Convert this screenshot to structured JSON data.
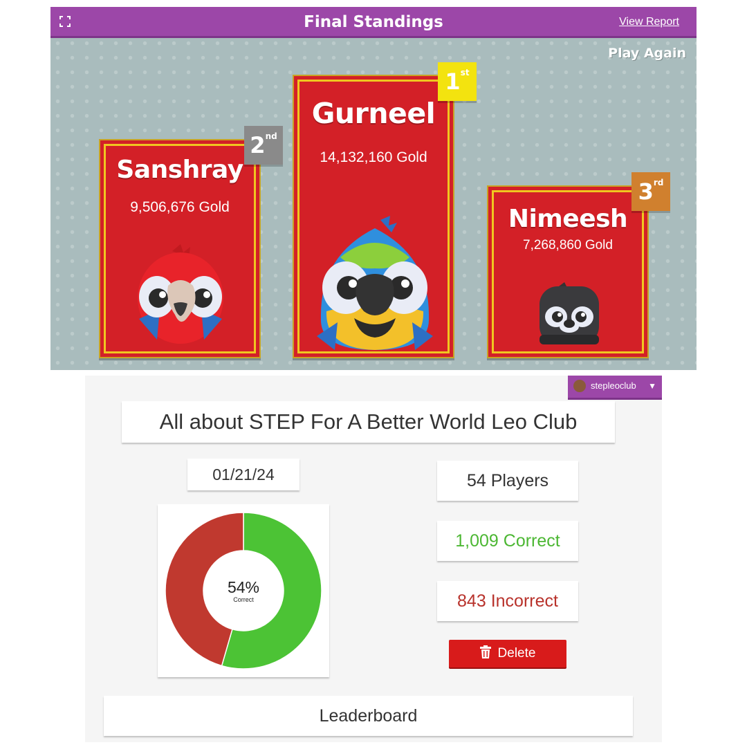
{
  "header": {
    "title": "Final Standings",
    "view_report": "View Report",
    "play_again": "Play Again"
  },
  "podium": [
    {
      "place": 2,
      "rank_label": "2",
      "rank_suffix": "nd",
      "name": "Sanshray",
      "gold": "9,506,676 Gold",
      "avatar": "red-parrot-icon",
      "rank_color": "#8a8a8a"
    },
    {
      "place": 1,
      "rank_label": "1",
      "rank_suffix": "st",
      "name": "Gurneel",
      "gold": "14,132,160 Gold",
      "avatar": "macaw-icon",
      "rank_color": "#f3e30f"
    },
    {
      "place": 3,
      "rank_label": "3",
      "rank_suffix": "rd",
      "name": "Nimeesh",
      "gold": "7,268,860 Gold",
      "avatar": "penguin-icon",
      "rank_color": "#d0802e"
    }
  ],
  "report": {
    "user": "stepleoclub",
    "kit_title": "All about STEP For A Better World Leo Club",
    "date": "01/21/24",
    "players": "54 Players",
    "correct": "1,009 Correct",
    "incorrect": "843 Incorrect",
    "delete_label": "Delete",
    "leaderboard_label": "Leaderboard"
  },
  "chart_data": {
    "type": "pie",
    "title": "",
    "center_value": "54%",
    "center_label": "Correct",
    "slices": [
      {
        "label": "Correct",
        "value": 1009,
        "color": "#4cc335"
      },
      {
        "label": "Incorrect",
        "value": 843,
        "color": "#c0392f"
      }
    ]
  },
  "colors": {
    "accent_purple": "#9c47a8",
    "card_red": "#d32027",
    "correct_green": "#4cc335",
    "incorrect_red": "#c0392f",
    "delete_red": "#d81b1b"
  }
}
